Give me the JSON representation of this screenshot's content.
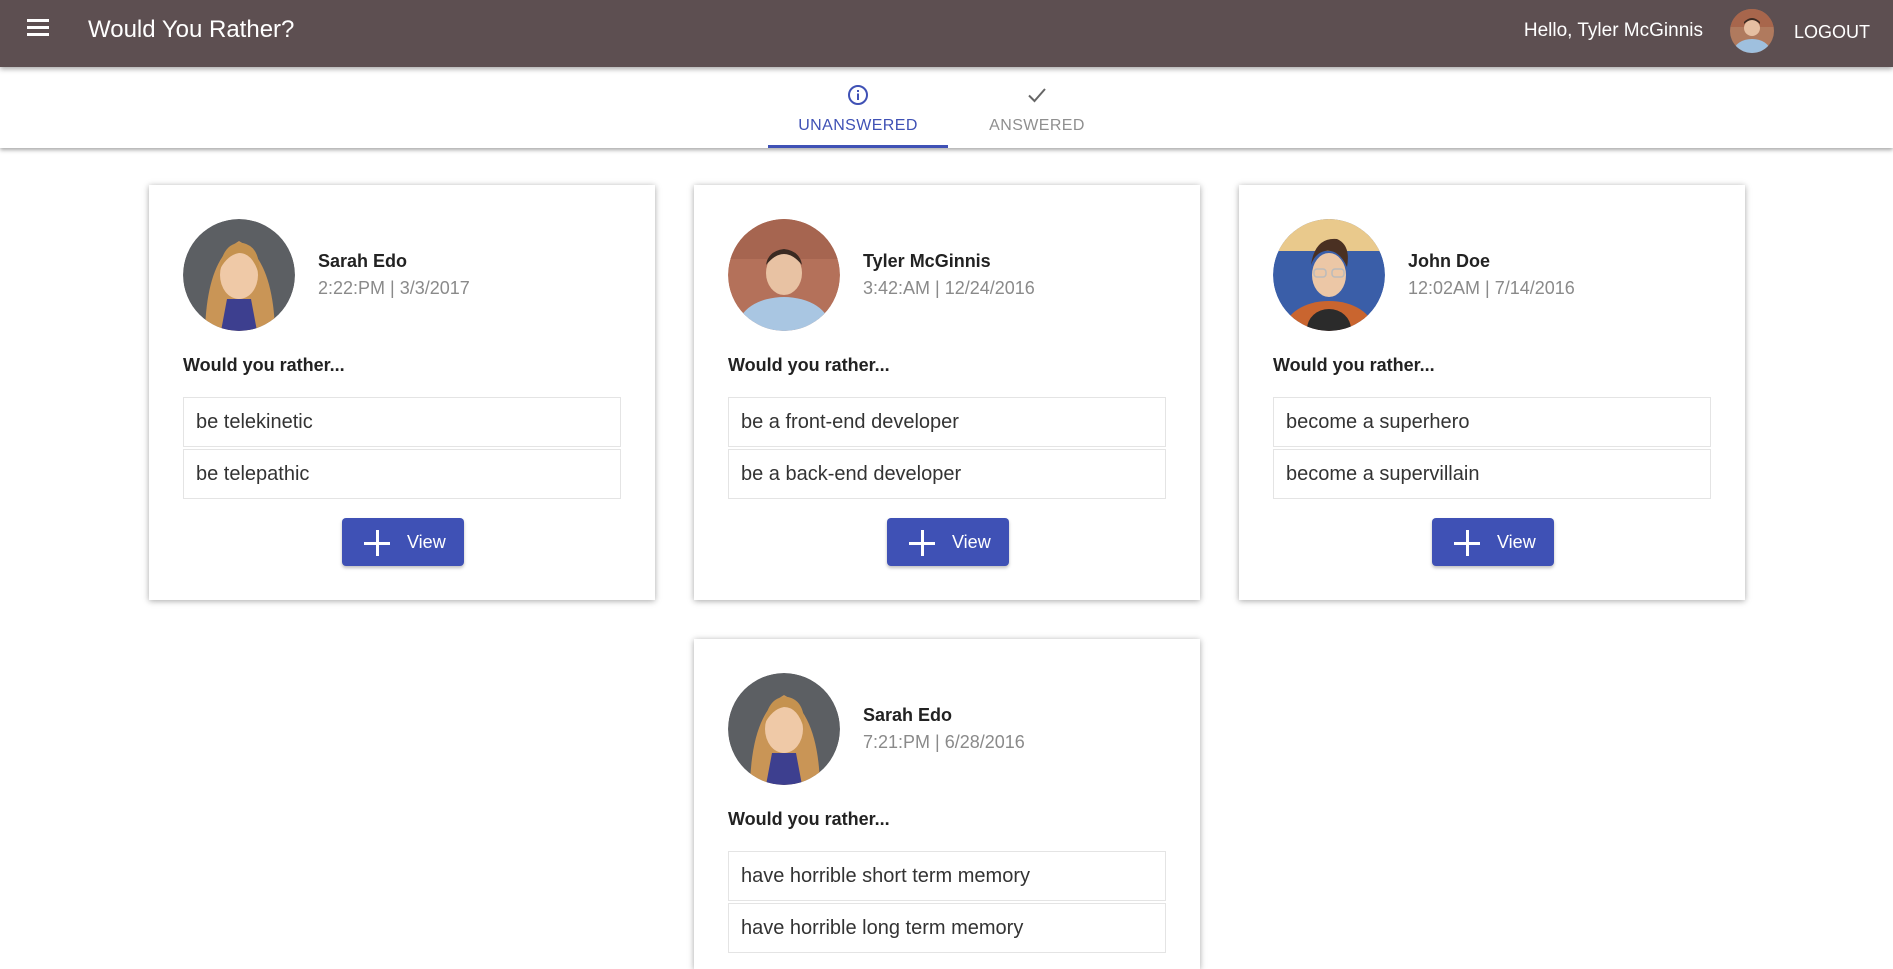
{
  "header": {
    "menu_icon": "menu-icon",
    "title": "Would You Rather?",
    "greeting": "Hello, Tyler McGinnis",
    "logout_label": "LOGOUT"
  },
  "tabs": [
    {
      "label": "UNANSWERED",
      "icon": "info-icon",
      "selected": true
    },
    {
      "label": "ANSWERED",
      "icon": "check-icon",
      "selected": false
    }
  ],
  "questions": [
    {
      "author": "Sarah Edo",
      "timestamp": "2:22:PM | 3/3/2017",
      "prompt": "Would you rather...",
      "option_one": "be telekinetic",
      "option_two": "be telepathic",
      "button_label": "View"
    },
    {
      "author": "Tyler McGinnis",
      "timestamp": "3:42:AM | 12/24/2016",
      "prompt": "Would you rather...",
      "option_one": "be a front-end developer",
      "option_two": "be a back-end developer",
      "button_label": "View"
    },
    {
      "author": "John Doe",
      "timestamp": "12:02AM | 7/14/2016",
      "prompt": "Would you rather...",
      "option_one": "become a superhero",
      "option_two": "become a supervillain",
      "button_label": "View"
    },
    {
      "author": "Sarah Edo",
      "timestamp": "7:21:PM | 6/28/2016",
      "prompt": "Would you rather...",
      "option_one": "have horrible short term memory",
      "option_two": "have horrible long term memory",
      "button_label": "View"
    }
  ],
  "colors": {
    "appbar": "#5d4f51",
    "accent": "#3f51b5",
    "muted_text": "#8a8a8a"
  }
}
